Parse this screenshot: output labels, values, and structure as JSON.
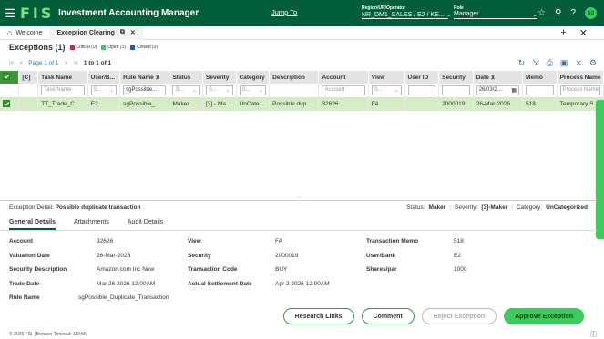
{
  "header": {
    "logo": "FIS",
    "app_title": "Investment Accounting Manager",
    "jump_to": "Jump To",
    "region_label": "Region/UR/Operator",
    "region_value": "NR_DM1_SALES / E2 / KE...",
    "role_label": "Role",
    "role_value": "Manager",
    "avatar": "SS"
  },
  "tabs": [
    {
      "label": "Welcome"
    },
    {
      "label": "Exception Clearing"
    }
  ],
  "exceptions": {
    "title": "Exceptions (1)",
    "legend": [
      {
        "label": "Critical (0)",
        "color": "#d9253a"
      },
      {
        "label": "Open (1)",
        "color": "#3ccb5c"
      },
      {
        "label": "Closed (0)",
        "color": "#1f5fa8"
      }
    ]
  },
  "pager": {
    "text": "Page 1 of 1",
    "range": "1 to 1 of 1"
  },
  "grid": {
    "columns": [
      "",
      "[C]",
      "Task Name",
      "User/B...",
      "Rule Name",
      "Status",
      "Severity",
      "Category",
      "Description",
      "Account",
      "View",
      "User ID",
      "Security",
      "Date",
      "Memo",
      "Process Name"
    ],
    "filters": {
      "task_name": "Task Name",
      "user_b": "S...",
      "rule_name": "sgPossible...",
      "status": "S...",
      "severity": "S...",
      "category": "S...",
      "account": "Account",
      "view": "S...",
      "date": "26/03/2...",
      "process_name": "Process Name"
    },
    "rows": [
      {
        "c": "",
        "task_name": "TT_Trade_C...",
        "user_b": "E2",
        "rule_name": "sgPossible_...",
        "status": "Maker ...",
        "severity": "[3] - Ma...",
        "category": "UnCate...",
        "description": "Possible dup...",
        "account": "32626",
        "view": "FA",
        "user_id": "",
        "security": "2000019",
        "date": "26-Mar-2026",
        "memo": "518",
        "process_name": "Temporary S..."
      }
    ]
  },
  "detail": {
    "label": "Exception Detail:",
    "title": "Possible duplicate transaction",
    "status_label": "Status:",
    "status_value": "Maker",
    "severity_label": "Severity:",
    "severity_value": "[3]-Maker",
    "category_label": "Category:",
    "category_value": "UnCategorized",
    "tabs": [
      "General Details",
      "Attachments",
      "Audit Details"
    ],
    "fields": {
      "account": {
        "label": "Account",
        "value": "32626"
      },
      "view": {
        "label": "View",
        "value": "FA"
      },
      "transaction_memo": {
        "label": "Transaction Memo",
        "value": "518"
      },
      "valuation_date": {
        "label": "Valuation Date",
        "value": "26-Mar-2026"
      },
      "security": {
        "label": "Security",
        "value": "2000019"
      },
      "user_bank": {
        "label": "User/Bank",
        "value": "E2"
      },
      "security_description": {
        "label": "Security Description",
        "value": "Amazon.com Inc New"
      },
      "transaction_code": {
        "label": "Transaction Code",
        "value": "BUY"
      },
      "shares_par": {
        "label": "Shares/par",
        "value": "1000"
      },
      "trade_date": {
        "label": "Trade Date",
        "value": "Mar 26 2026 12:00AM"
      },
      "actual_settlement_date": {
        "label": "Actual Settlement Date",
        "value": "Apr 2 2026 12:00AM"
      },
      "rule_name": {
        "label": "Rule Name",
        "value": "sgPossible_Duplicate_Transaction"
      }
    }
  },
  "buttons": {
    "research_links": "Research Links",
    "comment": "Comment",
    "reject_exception": "Reject Exception",
    "approve_exception": "Approve Exception"
  },
  "footer": {
    "copyright": "© 2026 FIS",
    "timeout": "[Browser Timeout: 119:55]"
  }
}
